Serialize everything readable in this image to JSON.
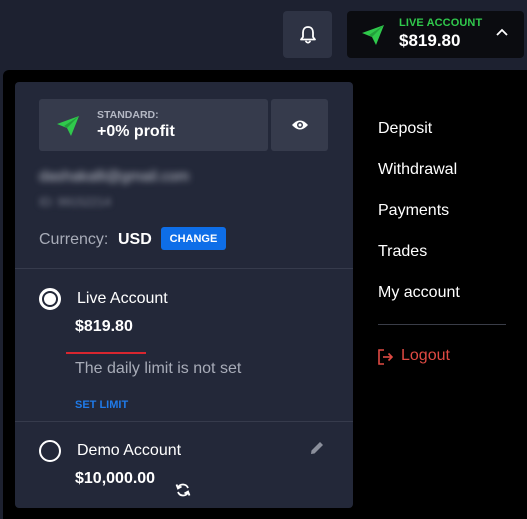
{
  "header": {
    "notifications": {
      "icon": "bell-icon"
    },
    "account": {
      "type_label": "LIVE ACCOUNT",
      "balance": "$819.80",
      "icon": "paper-plane-icon",
      "accent": "#30c94c"
    }
  },
  "panel": {
    "plan": {
      "name": "STANDARD:",
      "profit": "+0% profit",
      "icon": "paper-plane-icon"
    },
    "visibility_icon": "eye-icon",
    "email": "dashakalli@gmail.com",
    "account_id": "ID: 99152214",
    "currency_label": "Currency:",
    "currency_value": "USD",
    "change_label": "CHANGE",
    "accounts": [
      {
        "name": "Live Account",
        "amount": "$819.80",
        "selected": true,
        "limit_text": "The daily limit is not set",
        "set_limit_label": "SET LIMIT"
      },
      {
        "name": "Demo Account",
        "amount": "$10,000.00",
        "selected": false
      }
    ]
  },
  "menu": {
    "items": [
      {
        "label": "Deposit"
      },
      {
        "label": "Withdrawal"
      },
      {
        "label": "Payments"
      },
      {
        "label": "Trades"
      },
      {
        "label": "My account"
      }
    ],
    "logout_label": "Logout",
    "logout_color": "#e04a43"
  }
}
